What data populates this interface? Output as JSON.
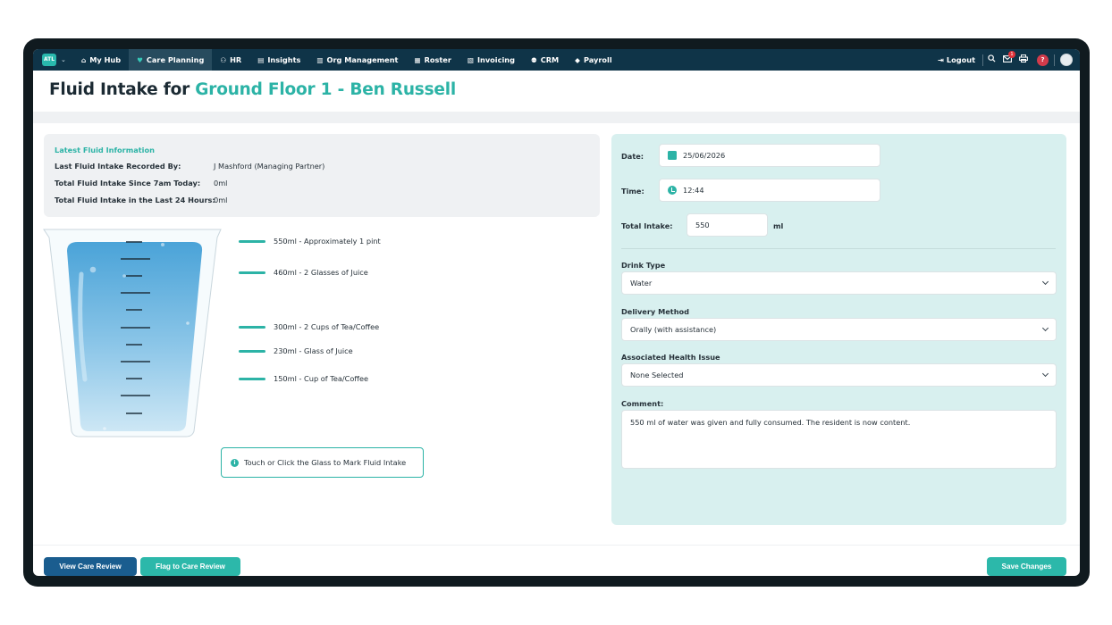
{
  "brand": {
    "logo_text": "ATL"
  },
  "nav": {
    "items": [
      {
        "label": "My Hub",
        "icon": "home-icon",
        "glyph": "⌂"
      },
      {
        "label": "Care Planning",
        "icon": "heart-icon",
        "glyph": "♥"
      },
      {
        "label": "HR",
        "icon": "people-icon",
        "glyph": "⚇"
      },
      {
        "label": "Insights",
        "icon": "chart-icon",
        "glyph": "▤"
      },
      {
        "label": "Org Management",
        "icon": "building-icon",
        "glyph": "▥"
      },
      {
        "label": "Roster",
        "icon": "calendar-icon",
        "glyph": "▦"
      },
      {
        "label": "Invoicing",
        "icon": "invoice-icon",
        "glyph": "▧"
      },
      {
        "label": "CRM",
        "icon": "contacts-icon",
        "glyph": "⚉"
      },
      {
        "label": "Payroll",
        "icon": "tag-icon",
        "glyph": "◆"
      }
    ],
    "logout_label": "Logout",
    "notification_count": "1",
    "help_glyph": "?"
  },
  "page": {
    "title_prefix": "Fluid Intake for ",
    "title_subject": "Ground Floor 1 - Ben Russell"
  },
  "info": {
    "heading": "Latest Fluid Information",
    "rows": [
      {
        "label": "Last Fluid Intake Recorded By:",
        "value": "J Mashford (Managing Partner)"
      },
      {
        "label": "Total Fluid Intake Since 7am Today:",
        "value": "0ml"
      },
      {
        "label": "Total Fluid Intake in the Last 24 Hours:",
        "value": "0ml"
      }
    ]
  },
  "measures": [
    {
      "label": "550ml - Approximately 1 pint"
    },
    {
      "label": "460ml - 2 Glasses of Juice"
    },
    {
      "label": "300ml - 2 Cups of Tea/Coffee"
    },
    {
      "label": "230ml - Glass of Juice"
    },
    {
      "label": "150ml - Cup of Tea/Coffee"
    }
  ],
  "hint": {
    "text": "Touch or Click the Glass to Mark Fluid Intake"
  },
  "form": {
    "date_label": "Date:",
    "date_value": "25/06/2026",
    "time_label": "Time:",
    "time_value": "12:44",
    "total_label": "Total Intake:",
    "total_value": "550",
    "total_unit": "ml",
    "drink_type_label": "Drink Type",
    "drink_type_value": "Water",
    "delivery_label": "Delivery Method",
    "delivery_value": "Orally (with assistance)",
    "health_label": "Associated Health Issue",
    "health_value": "None Selected",
    "comment_label": "Comment:",
    "comment_value": "550 ml of water was given and fully consumed. The resident is now content."
  },
  "buttons": {
    "view_care_review": "View Care Review",
    "flag_care_review": "Flag to Care Review",
    "save_changes": "Save Changes"
  },
  "colors": {
    "accent": "#2cb3a6",
    "nav_bg": "#0f3448",
    "primary_button": "#1a5d8f"
  }
}
